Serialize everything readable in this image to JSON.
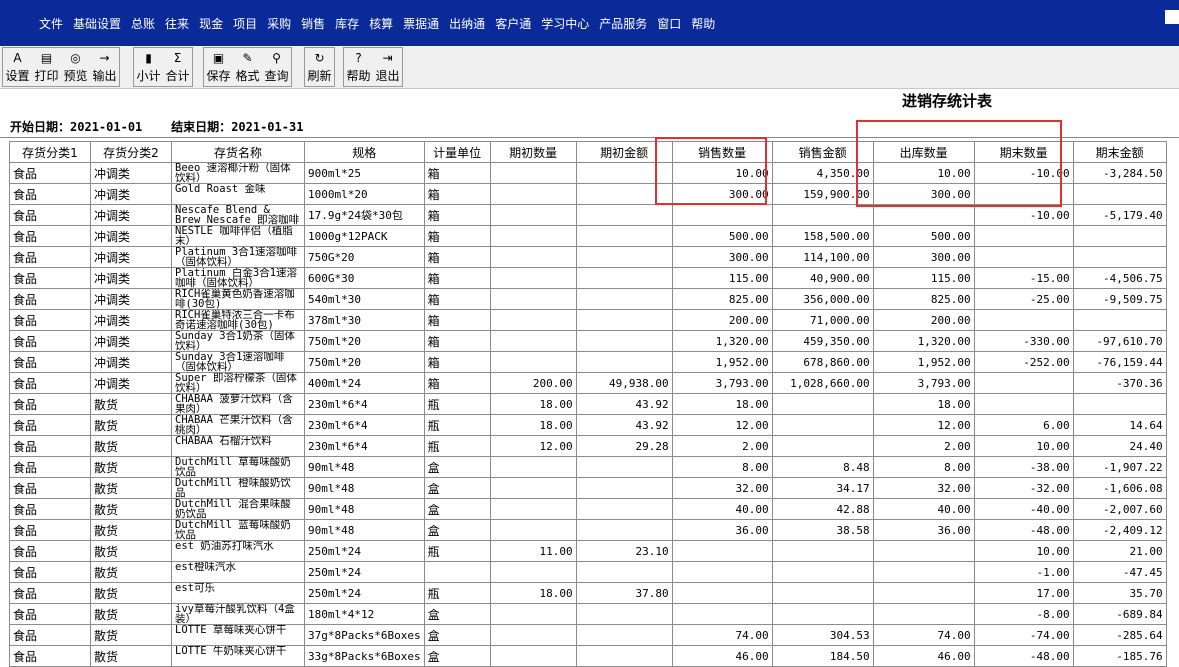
{
  "menubar": {
    "items": [
      "文件",
      "基础设置",
      "总账",
      "往来",
      "现金",
      "项目",
      "采购",
      "销售",
      "库存",
      "核算",
      "票据通",
      "出纳通",
      "客户通",
      "学习中心",
      "产品服务",
      "窗口",
      "帮助"
    ]
  },
  "toolbar": {
    "groups": [
      [
        {
          "label": "设置",
          "icon": "setup-icon",
          "glyph": "A"
        },
        {
          "label": "打印",
          "icon": "print-icon",
          "glyph": "▤"
        },
        {
          "label": "预览",
          "icon": "preview-icon",
          "glyph": "◎"
        },
        {
          "label": "输出",
          "icon": "export-icon",
          "glyph": "→"
        }
      ],
      [
        {
          "label": "小计",
          "icon": "subtotal-icon",
          "glyph": "▮"
        },
        {
          "label": "合计",
          "icon": "total-icon",
          "glyph": "Σ"
        }
      ],
      [
        {
          "label": "保存",
          "icon": "save-icon",
          "glyph": "▣"
        },
        {
          "label": "格式",
          "icon": "format-icon",
          "glyph": "✎"
        },
        {
          "label": "查询",
          "icon": "query-icon",
          "glyph": "⚲"
        }
      ],
      [
        {
          "label": "刷新",
          "icon": "refresh-icon",
          "glyph": "↻"
        }
      ],
      [
        {
          "label": "帮助",
          "icon": "help-icon",
          "glyph": "?"
        },
        {
          "label": "退出",
          "icon": "exit-icon",
          "glyph": "⇥"
        }
      ]
    ]
  },
  "report": {
    "title": "进销存统计表",
    "start_label": "开始日期：",
    "start_date": "2021-01-01",
    "end_label": "结束日期：",
    "end_date": "2021-01-31"
  },
  "table": {
    "columns": [
      "存货分类1",
      "存货分类2",
      "存货名称",
      "规格",
      "计量单位",
      "期初数量",
      "期初金额",
      "销售数量",
      "销售金额",
      "出库数量",
      "期末数量",
      "期末金额"
    ],
    "rows": [
      [
        "食品",
        "冲调类",
        "Beeo 速溶椰汁粉（固体饮料）",
        "900ml*25",
        "箱",
        "",
        "",
        "10.00",
        "4,350.00",
        "10.00",
        "-10.00",
        "-3,284.50"
      ],
      [
        "食品",
        "冲调类",
        "Gold Roast 金味",
        "1000ml*20",
        "箱",
        "",
        "",
        "300.00",
        "159,900.00",
        "300.00",
        "",
        ""
      ],
      [
        "食品",
        "冲调类",
        "Nescafe Blend & Brew Nescafe 即溶咖啡",
        "17.9g*24袋*30包",
        "箱",
        "",
        "",
        "",
        "",
        "",
        "-10.00",
        "-5,179.40"
      ],
      [
        "食品",
        "冲调类",
        "NESTLE 咖啡伴侣（植脂末）",
        "1000g*12PACK",
        "箱",
        "",
        "",
        "500.00",
        "158,500.00",
        "500.00",
        "",
        ""
      ],
      [
        "食品",
        "冲调类",
        "Platinum 3合1速溶咖啡（固体饮料）",
        "750G*20",
        "箱",
        "",
        "",
        "300.00",
        "114,100.00",
        "300.00",
        "",
        ""
      ],
      [
        "食品",
        "冲调类",
        "Platinum 白金3合1速溶咖啡（固体饮料）",
        "600G*30",
        "箱",
        "",
        "",
        "115.00",
        "40,900.00",
        "115.00",
        "-15.00",
        "-4,506.75"
      ],
      [
        "食品",
        "冲调类",
        "RICH雀巢黄色奶香速溶咖啡(30包)",
        "540ml*30",
        "箱",
        "",
        "",
        "825.00",
        "356,000.00",
        "825.00",
        "-25.00",
        "-9,509.75"
      ],
      [
        "食品",
        "冲调类",
        "RICH雀巢特浓三合一卡布奇诺速溶咖啡(30包)",
        "378ml*30",
        "箱",
        "",
        "",
        "200.00",
        "71,000.00",
        "200.00",
        "",
        ""
      ],
      [
        "食品",
        "冲调类",
        "Sunday 3合1奶茶（固体饮料）",
        "750ml*20",
        "箱",
        "",
        "",
        "1,320.00",
        "459,350.00",
        "1,320.00",
        "-330.00",
        "-97,610.70"
      ],
      [
        "食品",
        "冲调类",
        "Sunday 3合1速溶咖啡（固体饮料）",
        "750ml*20",
        "箱",
        "",
        "",
        "1,952.00",
        "678,860.00",
        "1,952.00",
        "-252.00",
        "-76,159.44"
      ],
      [
        "食品",
        "冲调类",
        "Super 即溶柠檬茶（固体饮料）",
        "400ml*24",
        "箱",
        "200.00",
        "49,938.00",
        "3,793.00",
        "1,028,660.00",
        "3,793.00",
        "",
        "-370.36"
      ],
      [
        "食品",
        "散货",
        "CHABAA 菠萝汁饮料（含果肉）",
        "230ml*6*4",
        "瓶",
        "18.00",
        "43.92",
        "18.00",
        "",
        "18.00",
        "",
        ""
      ],
      [
        "食品",
        "散货",
        "CHABAA 芒果汁饮料（含桃肉）",
        "230ml*6*4",
        "瓶",
        "18.00",
        "43.92",
        "12.00",
        "",
        "12.00",
        "6.00",
        "14.64"
      ],
      [
        "食品",
        "散货",
        "CHABAA 石榴汁饮料",
        "230ml*6*4",
        "瓶",
        "12.00",
        "29.28",
        "2.00",
        "",
        "2.00",
        "10.00",
        "24.40"
      ],
      [
        "食品",
        "散货",
        "DutchMill 草莓味酸奶饮品",
        "90ml*48",
        "盒",
        "",
        "",
        "8.00",
        "8.48",
        "8.00",
        "-38.00",
        "-1,907.22"
      ],
      [
        "食品",
        "散货",
        "DutchMill 橙味酸奶饮品",
        "90ml*48",
        "盒",
        "",
        "",
        "32.00",
        "34.17",
        "32.00",
        "-32.00",
        "-1,606.08"
      ],
      [
        "食品",
        "散货",
        "DutchMill 混合果味酸奶饮品",
        "90ml*48",
        "盒",
        "",
        "",
        "40.00",
        "42.88",
        "40.00",
        "-40.00",
        "-2,007.60"
      ],
      [
        "食品",
        "散货",
        "DutchMill 蓝莓味酸奶饮品",
        "90ml*48",
        "盒",
        "",
        "",
        "36.00",
        "38.58",
        "36.00",
        "-48.00",
        "-2,409.12"
      ],
      [
        "食品",
        "散货",
        "est 奶油苏打味汽水",
        "250ml*24",
        "瓶",
        "11.00",
        "23.10",
        "",
        "",
        "",
        "10.00",
        "21.00"
      ],
      [
        "食品",
        "散货",
        "est橙味汽水",
        "250ml*24",
        "",
        "",
        "",
        "",
        "",
        "",
        "-1.00",
        "-47.45"
      ],
      [
        "食品",
        "散货",
        "est可乐",
        "250ml*24",
        "瓶",
        "18.00",
        "37.80",
        "",
        "",
        "",
        "17.00",
        "35.70"
      ],
      [
        "食品",
        "散货",
        "ivy草莓汁酸乳饮料（4盒装）",
        "180ml*4*12",
        "盒",
        "",
        "",
        "",
        "",
        "",
        "-8.00",
        "-689.84"
      ],
      [
        "食品",
        "散货",
        "LOTTE 草莓味夹心饼干",
        "37g*8Packs*6Boxes",
        "盒",
        "",
        "",
        "74.00",
        "304.53",
        "74.00",
        "-74.00",
        "-285.64"
      ],
      [
        "食品",
        "散货",
        "LOTTE 牛奶味夹心饼干",
        "33g*8Packs*6Boxes",
        "盒",
        "",
        "",
        "46.00",
        "184.50",
        "46.00",
        "-48.00",
        "-185.76"
      ]
    ]
  },
  "colors": {
    "menubar": "#0a2a9a",
    "highlight": "#e03030"
  }
}
